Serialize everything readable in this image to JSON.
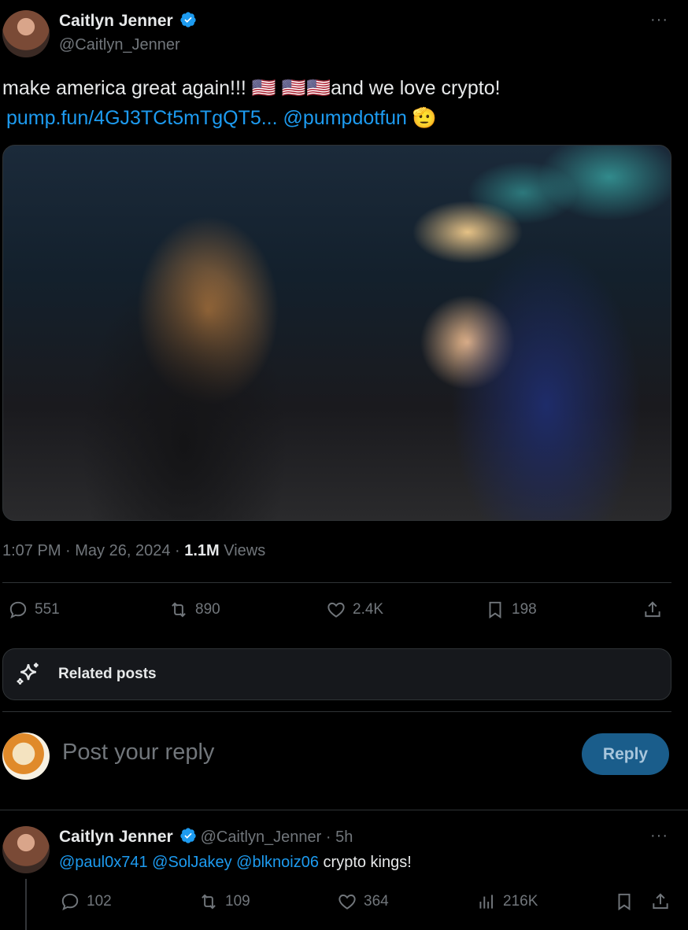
{
  "tweet": {
    "author_name": "Caitlyn Jenner",
    "author_handle": "@Caitlyn_Jenner",
    "more_label": "···",
    "text_line1": "make america great again!!! 🇺🇸 🇺🇸🇺🇸and we love crypto!",
    "link_url": "pump.fun/4GJ3TCt5mTgQT5...",
    "link_mention": "@pumpdotfun",
    "emoji_end": "🫡",
    "timestamp": "1:07 PM · May 26, 2024 · ",
    "views_count": "1.1M",
    "views_label": " Views",
    "replies": "551",
    "retweets": "890",
    "likes": "2.4K",
    "bookmarks": "198"
  },
  "related": {
    "label": "Related posts",
    "icon": "sparkle-icon"
  },
  "compose": {
    "placeholder": "Post your reply",
    "button_label": "Reply"
  },
  "reply_tweet": {
    "author_name": "Caitlyn Jenner",
    "author_handle": "@Caitlyn_Jenner",
    "time": " · 5h",
    "more_label": "···",
    "mentions": "@paul0x741 @SolJakey @blknoiz06",
    "text": " crypto kings!",
    "replies": "102",
    "retweets": "109",
    "likes": "364",
    "views": "216K"
  },
  "colors": {
    "accent": "#1d9bf0",
    "muted": "#71767b",
    "text": "#e7e9ea",
    "background": "#000000"
  }
}
